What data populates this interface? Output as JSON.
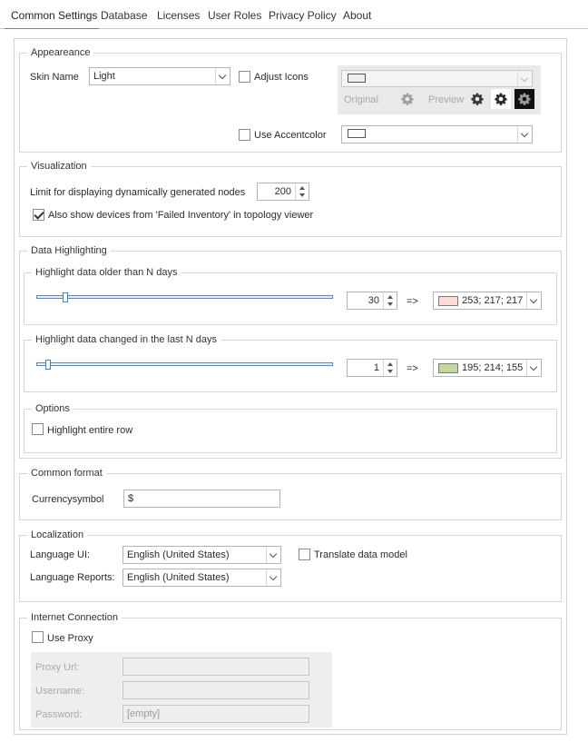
{
  "tabs": [
    {
      "label": "Common Settings",
      "active": true
    },
    {
      "label": "Database"
    },
    {
      "label": "Licenses"
    },
    {
      "label": "User Roles"
    },
    {
      "label": "Privacy Policy"
    },
    {
      "label": "About"
    }
  ],
  "appearance": {
    "legend": "Appeareance",
    "skin_name_label": "Skin Name",
    "skin_name_value": "Light",
    "adjust_icons_label": "Adjust Icons",
    "adjust_icons_checked": false,
    "icon_original_label": "Original",
    "icon_preview_label": "Preview",
    "use_accentcolor_label": "Use Accentcolor",
    "use_accentcolor_checked": false
  },
  "visualization": {
    "legend": "Visualization",
    "limit_label": "Limit for displaying dynamically generated nodes",
    "limit_value": "200",
    "failed_inventory_label": "Also show devices from 'Failed Inventory' in topology viewer",
    "failed_inventory_checked": true
  },
  "data_highlighting": {
    "legend": "Data Highlighting",
    "older": {
      "legend": "Highlight data older than N days",
      "value": "30",
      "slider_fraction": 0.09,
      "arrow": "=>",
      "color_text": "253; 217; 217",
      "color_hex": "#fdd9d9"
    },
    "changed": {
      "legend": "Highlight data changed in the last N days",
      "value": "1",
      "slider_fraction": 0.03,
      "arrow": "=>",
      "color_text": "195; 214; 155",
      "color_hex": "#c3d69b"
    },
    "options": {
      "legend": "Options",
      "highlight_row_label": "Highlight entire row",
      "highlight_row_checked": false
    }
  },
  "common_format": {
    "legend": "Common format",
    "currency_label": "Currencysymbol",
    "currency_value": "$"
  },
  "localization": {
    "legend": "Localization",
    "language_ui_label": "Language UI:",
    "language_ui_value": "English (United States)",
    "language_reports_label": "Language Reports:",
    "language_reports_value": "English (United States)",
    "translate_label": "Translate data model",
    "translate_checked": false
  },
  "internet": {
    "legend": "Internet Connection",
    "use_proxy_label": "Use Proxy",
    "use_proxy_checked": false,
    "proxy_url_label": "Proxy Url:",
    "proxy_url_value": "",
    "username_label": "Username:",
    "username_value": "",
    "password_label": "Password:",
    "password_value": "[empty]"
  },
  "colors": {
    "accent_blue": "#5a87b8",
    "border": "#d6d6d6"
  }
}
